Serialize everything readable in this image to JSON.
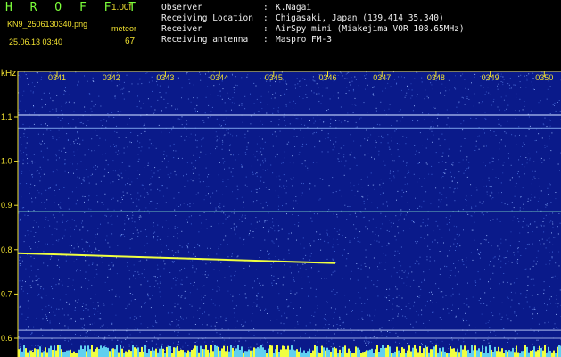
{
  "header": {
    "app_title": "H R O F F T",
    "version": "1.00f",
    "filename": "KN9_2506130340.png",
    "datetime": "25.06.13 03:40",
    "meteor_label": "meteor",
    "meteor_count": "67"
  },
  "info": [
    {
      "key": "Observer",
      "sep": ":",
      "value": "K.Nagai"
    },
    {
      "key": "Receiving Location",
      "sep": ":",
      "value": "Chigasaki, Japan (139.414 35.340)"
    },
    {
      "key": "Receiver",
      "sep": ":",
      "value": "AirSpy mini (Miakejima VOR 108.65MHz)"
    },
    {
      "key": "Receiving antenna",
      "sep": ":",
      "value": "Maspro FM-3"
    }
  ],
  "spectrogram": {
    "y_unit_label": "kHz",
    "y_ticks": [
      "1.1",
      "1.0",
      "0.9",
      "0.8",
      "0.7",
      "0.6"
    ],
    "time_ticks": [
      "0341",
      "0342",
      "0343",
      "0344",
      "0345",
      "0346",
      "0347",
      "0348",
      "0349",
      "0350"
    ],
    "colors": {
      "background": "#0a1a8a",
      "noise": "#5a7ad8",
      "signal": "#7ad0c0",
      "meteor": "#f0ff40",
      "axis": "#f0e030"
    }
  }
}
